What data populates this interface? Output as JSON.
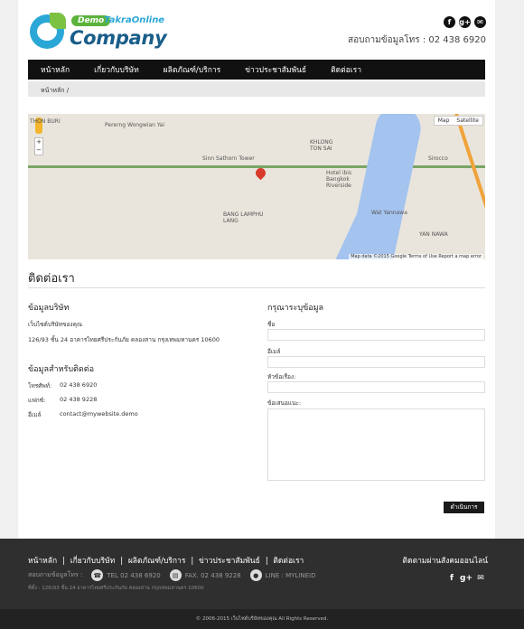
{
  "header": {
    "badge": "Demo",
    "brand_sub": "TakraOnline",
    "brand_main": "Company",
    "phone_text": "สอบถามข้อมูลโทร : 02 438 6920",
    "social": [
      "f",
      "g+",
      "✉"
    ]
  },
  "nav": [
    "หน้าหลัก",
    "เกี่ยวกับบริษัท",
    "ผลิตภัณฑ์/บริการ",
    "ข่าวประชาสัมพันธ์",
    "ติดต่อเรา"
  ],
  "breadcrumb": "หน้าหลัก  /",
  "map": {
    "labels": {
      "thonburi": "THON BURI",
      "wongwian": "Pererng Wongwian Yai",
      "khlong": "KHLONG TON SAI",
      "tower": "Sinn Sathorn Tower",
      "hotel": "Hotel ibis Bangkok Riverside",
      "sirocco": "Sirocco",
      "lamphu": "BANG LAMPHU LANG",
      "yannawa": "YAN NAWA",
      "wat": "Wat Yannawa"
    },
    "toggle_map": "Map",
    "toggle_satellite": "Satellite",
    "footer": "Map data ©2015 Google   Terms of Use   Report a map error"
  },
  "contact": {
    "title": "ติดต่อเรา",
    "company_heading": "ข้อมูลบริษัท",
    "company_name": "เว็บไซต์บริษัทของคุณ",
    "address": "126/93 ชั้น 24 อาคารไทยศรีประกันภัย คลองสาน กรุงเทพมหานคร 10600",
    "contact_heading": "ข้อมูลสำหรับติดต่อ",
    "phone_label": "โทรศัพท์:",
    "phone_value": "02 438 6920",
    "fax_label": "แฟกซ์:",
    "fax_value": "02 438 9228",
    "email_label": "อีเมล์",
    "email_value": "contact@mywebsite.demo"
  },
  "form": {
    "heading": "กรุณาระบุข้อมูล",
    "name_label": "ชื่อ",
    "email_label": "อีเมล์",
    "subject_label": "หัวข้อเรื่อง:",
    "message_label": "ข้อเสนอแนะ:",
    "submit_label": "ดำเนินการ"
  },
  "footer": {
    "nav": [
      "หน้าหลัก",
      "เกี่ยวกับบริษัท",
      "ผลิตภัณฑ์/บริการ",
      "ข่าวประชาสัมพันธ์",
      "ติดต่อเรา"
    ],
    "follow": "ติดตามผ่านสังคมออนไลน์",
    "inquiry_label": "สอบถามข้อมูลโทร :",
    "tel": "TEL 02 438 6920",
    "fax": "FAX. 02 438 9228",
    "line": "LINE : MYLINEID",
    "address": "ที่ตั้ง : 126/93 ชั้น 24 อาคารไทยศรีประกันภัย คลองสาน กรุงเทพมหานคร 10600",
    "copyright": "© 2006-2015 เว็บไซต์บริษัทของคุณ All Rights Reserved."
  }
}
